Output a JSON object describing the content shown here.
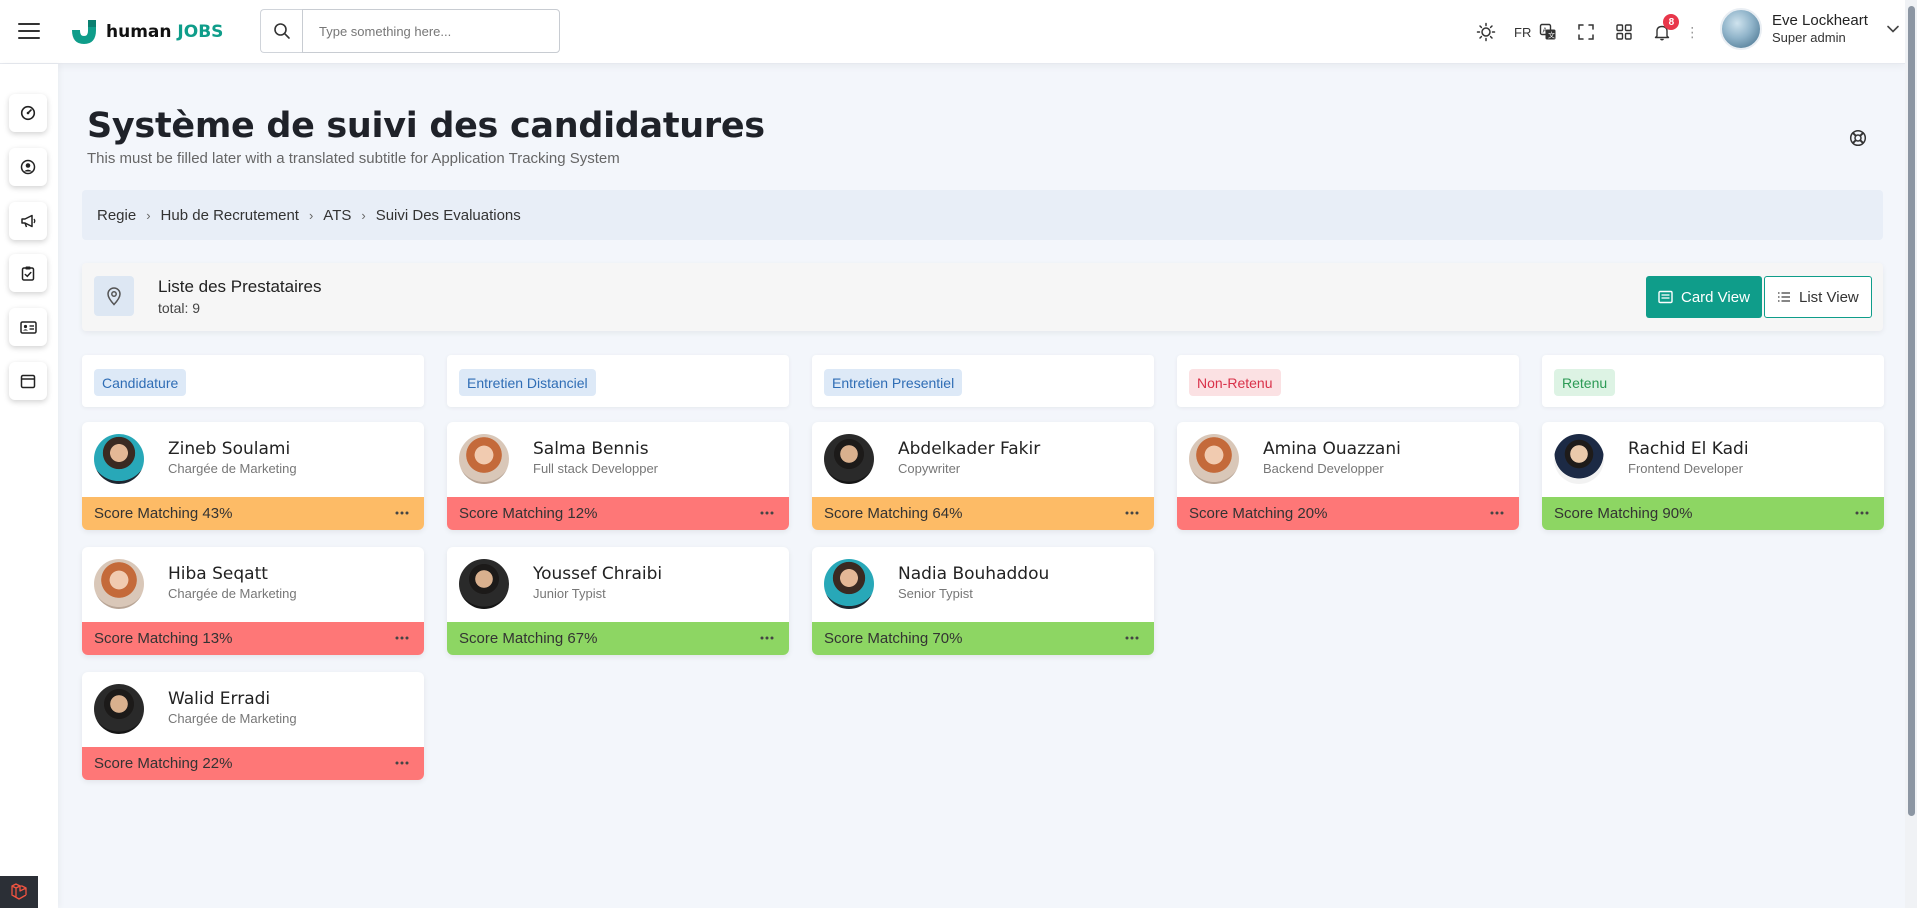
{
  "app": {
    "logo_word": "human",
    "logo_accent": "JOBS",
    "brand_color": "#0f9d8a"
  },
  "search": {
    "placeholder": "Type something here...",
    "value": ""
  },
  "topbar": {
    "language": "FR",
    "notifications": "8",
    "user_name": "Eve Lockheart",
    "user_role": "Super admin"
  },
  "page": {
    "title": "Système de suivi des candidatures",
    "subtitle": "This must be filled later with a translated subtitle for Application Tracking System"
  },
  "breadcrumb": [
    "Regie",
    "Hub de Recrutement",
    "ATS",
    "Suivi Des Evaluations"
  ],
  "providers": {
    "title": "Liste des Prestataires",
    "total": "total: 9",
    "card_view": "Card View",
    "list_view": "List View"
  },
  "columns": [
    {
      "label": "Candidature",
      "tag_bg": "#dde9f7",
      "tag_fg": "#2f6db5",
      "cards": [
        {
          "name": "Zineb Soulami",
          "role": "Chargée de Marketing",
          "score": "Score Matching 43%",
          "level": "orange",
          "avatar": "woman-cyan"
        },
        {
          "name": "Hiba Seqatt",
          "role": "Chargée de Marketing",
          "score": "Score Matching 13%",
          "level": "red",
          "avatar": "woman-red"
        },
        {
          "name": "Walid Erradi",
          "role": "Chargée de Marketing",
          "score": "Score Matching 22%",
          "level": "red",
          "avatar": "man-dark"
        }
      ]
    },
    {
      "label": "Entretien Distanciel",
      "tag_bg": "#dde9f7",
      "tag_fg": "#2f6db5",
      "cards": [
        {
          "name": "Salma Bennis",
          "role": "Full stack Developper",
          "score": "Score Matching 12%",
          "level": "red",
          "avatar": "woman-red"
        },
        {
          "name": "Youssef Chraibi",
          "role": "Junior Typist",
          "score": "Score Matching 67%",
          "level": "green",
          "avatar": "man-dark"
        }
      ]
    },
    {
      "label": "Entretien Presentiel",
      "tag_bg": "#dde9f7",
      "tag_fg": "#2f6db5",
      "cards": [
        {
          "name": "Abdelkader Fakir",
          "role": "Copywriter",
          "score": "Score Matching 64%",
          "level": "orange",
          "avatar": "man-dark"
        },
        {
          "name": "Nadia Bouhaddou",
          "role": "Senior Typist",
          "score": "Score Matching 70%",
          "level": "green",
          "avatar": "woman-cyan"
        }
      ]
    },
    {
      "label": "Non-Retenu",
      "tag_bg": "#fbe1e3",
      "tag_fg": "#d9324a",
      "cards": [
        {
          "name": "Amina Ouazzani",
          "role": "Backend Developper",
          "score": "Score Matching 20%",
          "level": "red",
          "avatar": "woman-red"
        }
      ]
    },
    {
      "label": "Retenu",
      "tag_bg": "#ddf3e4",
      "tag_fg": "#2c9a55",
      "cards": [
        {
          "name": "Rachid El Kadi",
          "role": "Frontend Developer",
          "score": "Score Matching 90%",
          "level": "green",
          "avatar": "man-light"
        }
      ]
    }
  ],
  "score_colors": {
    "orange": "#fdbb66",
    "red": "#fe7777",
    "green": "#8dd663"
  },
  "icons": [
    "menu-icon",
    "search-icon",
    "sun-icon",
    "translate-icon",
    "fullscreen-icon",
    "apps-grid-icon",
    "bell-icon",
    "chevron-down-icon",
    "help-buoy-icon",
    "location-pin-icon",
    "card-view-icon",
    "list-view-icon",
    "more-dots-icon",
    "dashboard-icon",
    "user-circle-icon",
    "megaphone-icon",
    "clipboard-check-icon",
    "id-card-icon",
    "calendar-icon",
    "laravel-icon"
  ]
}
